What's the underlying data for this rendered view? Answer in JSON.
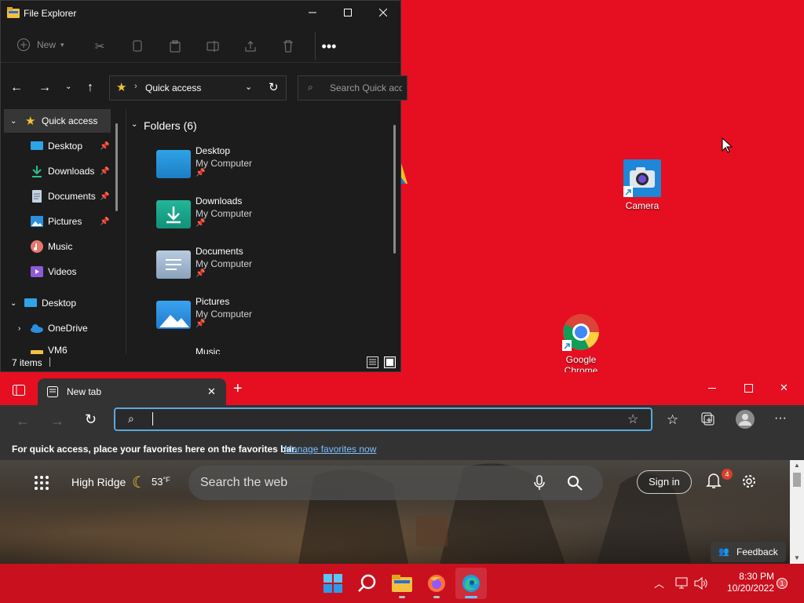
{
  "explorer": {
    "title": "File Explorer",
    "toolbar": {
      "new_label": "New"
    },
    "address": {
      "location": "Quick access"
    },
    "search": {
      "placeholder": "Search Quick access"
    },
    "nav": {
      "items": [
        {
          "label": "Quick access",
          "icon": "star-icon"
        },
        {
          "label": "Desktop",
          "icon": "desktop-folder-icon"
        },
        {
          "label": "Downloads",
          "icon": "download-icon"
        },
        {
          "label": "Documents",
          "icon": "document-icon"
        },
        {
          "label": "Pictures",
          "icon": "pictures-icon"
        },
        {
          "label": "Music",
          "icon": "music-icon"
        },
        {
          "label": "Videos",
          "icon": "videos-icon"
        },
        {
          "label": "Desktop",
          "icon": "desktop-icon"
        },
        {
          "label": "OneDrive",
          "icon": "cloud-icon"
        },
        {
          "label": "VM6",
          "icon": "folder-icon"
        }
      ]
    },
    "folders_header": "Folders (6)",
    "folders": [
      {
        "name": "Desktop",
        "sub": "My Computer",
        "color": "#2fa3e8"
      },
      {
        "name": "Downloads",
        "sub": "My Computer",
        "color": "#19a98e"
      },
      {
        "name": "Documents",
        "sub": "My Computer",
        "color": "#9fb6cc"
      },
      {
        "name": "Pictures",
        "sub": "My Computer",
        "color": "#2b8fe0"
      },
      {
        "name": "Music",
        "sub": "",
        "color": "#e08a2b"
      }
    ],
    "status": "7 items"
  },
  "desktop": {
    "icons": [
      {
        "label": "Camera"
      },
      {
        "label": "Google Chrome"
      }
    ]
  },
  "edge": {
    "tab_title": "New tab",
    "favbar_text": "For quick access, place your favorites here on the favorites bar.",
    "favbar_link": "Manage favorites now",
    "ntp": {
      "location": "High Ridge",
      "temp": "53",
      "temp_unit": "°F",
      "search_placeholder": "Search the web",
      "sign_in": "Sign in",
      "notif_count": "4",
      "feedback": "Feedback"
    }
  },
  "taskbar": {
    "time": "8:30 PM",
    "date": "10/20/2022",
    "notif_count": "1"
  }
}
